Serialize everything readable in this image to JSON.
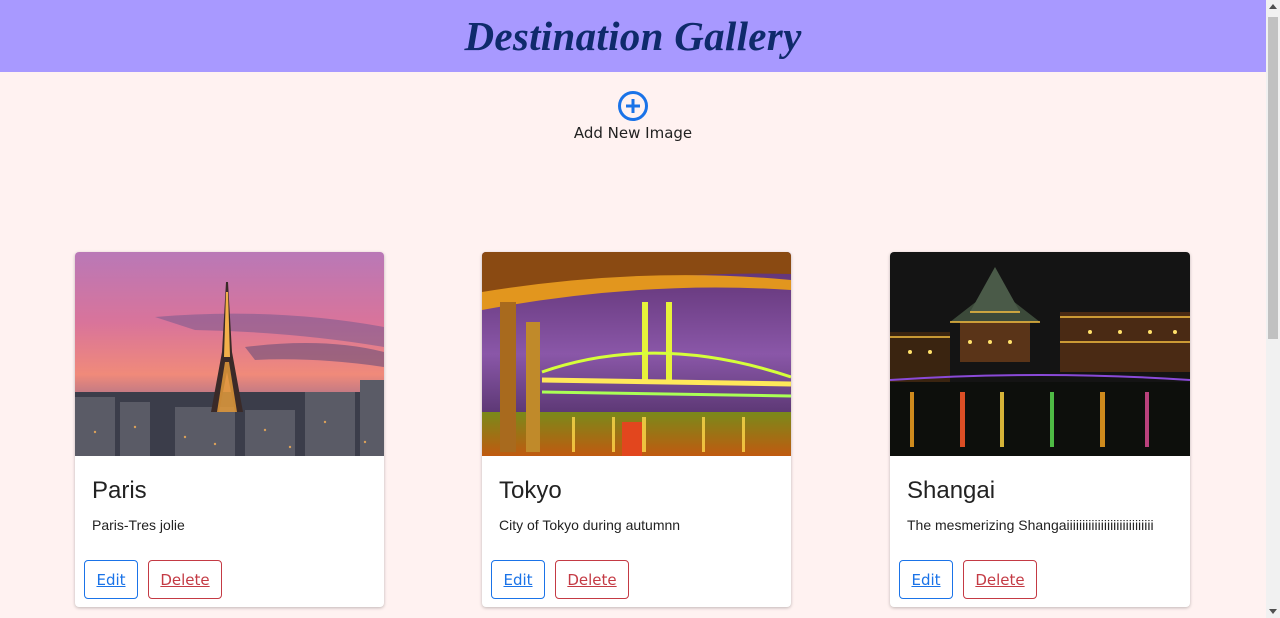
{
  "header": {
    "title": "Destination Gallery"
  },
  "add_new": {
    "label": "Add New Image",
    "icon": "plus-circle-icon"
  },
  "cards": [
    {
      "title": "Paris",
      "description": "Paris-Tres jolie",
      "edit_label": "Edit",
      "delete_label": "Delete"
    },
    {
      "title": "Tokyo",
      "description": "City of Tokyo during autumnn",
      "edit_label": "Edit",
      "delete_label": "Delete"
    },
    {
      "title": "Shangai",
      "description": "The mesmerizing Shangaiiiiiiiiiiiiiiiiiiiiiiiiiiii",
      "edit_label": "Edit",
      "delete_label": "Delete"
    }
  ],
  "colors": {
    "header_bg": "#a899ff",
    "title_color": "#0f2a6b",
    "page_bg": "#fff2f1",
    "edit": "#1a73e8",
    "delete": "#c43a44"
  }
}
